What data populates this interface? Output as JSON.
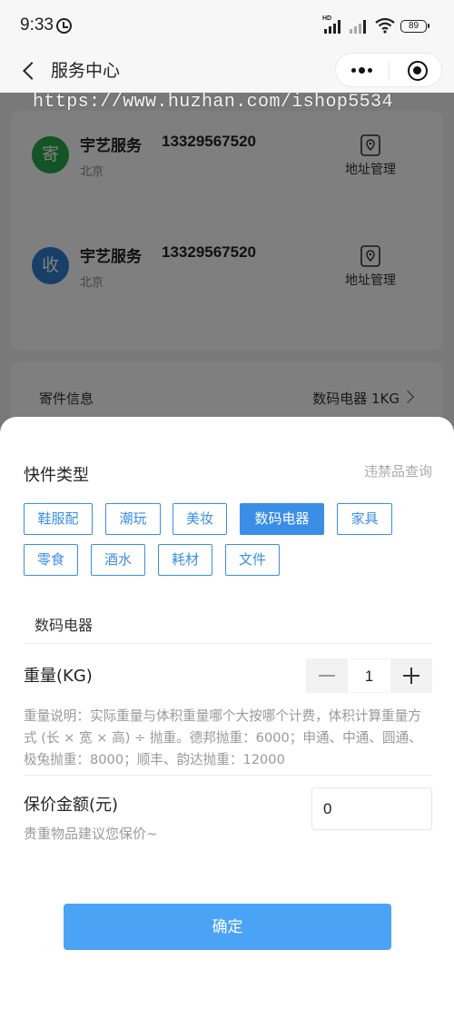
{
  "status_bar": {
    "time": "9:33",
    "hd": "HD",
    "battery": "89"
  },
  "nav": {
    "title": "服务中心"
  },
  "watermark": "https://www.huzhan.com/ishop5534",
  "background": {
    "sender": {
      "avatar_char": "寄",
      "avatar_color": "#27a84a",
      "name": "宇艺服务",
      "phone": "13329567520",
      "city": "北京",
      "manage_label": "地址管理"
    },
    "receiver": {
      "avatar_char": "收",
      "avatar_color": "#2f7fd1",
      "name": "宇艺服务",
      "phone": "13329567520",
      "city": "北京",
      "manage_label": "地址管理"
    },
    "send_info": {
      "label": "寄件信息",
      "value": "数码电器 1KG"
    }
  },
  "sheet": {
    "title": "快件类型",
    "banned_link": "违禁品查询",
    "types": [
      "鞋服配",
      "潮玩",
      "美妆",
      "数码电器",
      "家具",
      "零食",
      "酒水",
      "耗材",
      "文件"
    ],
    "selected_type": "数码电器",
    "weight": {
      "label": "重量(KG)",
      "value": "1",
      "desc": "重量说明：实际重量与体积重量哪个大按哪个计费，体积计算重量方式 (长 × 宽 × 高) ÷ 抛重。德邦抛重：6000；申通、中通、圆通、极兔抛重：8000；顺丰、韵达抛重：12000"
    },
    "insure": {
      "label": "保价金额(元)",
      "hint": "贵重物品建议您保价~",
      "value": "0"
    },
    "confirm_label": "确定"
  },
  "colors": {
    "accent": "#3a8ee6",
    "confirm": "#4aa3f5"
  }
}
